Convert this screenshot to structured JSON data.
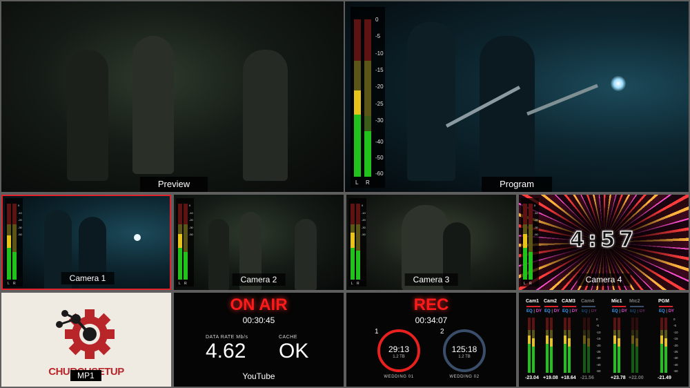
{
  "preview": {
    "label": "Preview"
  },
  "program": {
    "label": "Program",
    "meter_scale": [
      "0",
      "-5",
      "-10",
      "-15",
      "-20",
      "-25",
      "-30",
      "-40",
      "-50",
      "-60"
    ],
    "channels": [
      "L",
      "R"
    ]
  },
  "cameras": [
    {
      "label": "Camera 1",
      "meter_scale": [
        "0",
        "-5",
        "-10",
        "-15",
        "-20",
        "-25",
        "-30",
        "-40",
        "-50",
        "-60"
      ],
      "channels": [
        "L",
        "R"
      ]
    },
    {
      "label": "Camera 2",
      "meter_scale": [
        "0",
        "-5",
        "-10",
        "-15",
        "-20",
        "-25",
        "-30",
        "-40",
        "-50",
        "-60"
      ],
      "channels": [
        "L",
        "R"
      ]
    },
    {
      "label": "Camera 3",
      "meter_scale": [
        "0",
        "-5",
        "-10",
        "-15",
        "-20",
        "-25",
        "-30",
        "-40",
        "-50",
        "-60"
      ],
      "channels": [
        "L",
        "R"
      ]
    },
    {
      "label": "Camera 4",
      "meter_scale": [
        "0",
        "-5",
        "-10",
        "-15",
        "-20",
        "-25",
        "-30",
        "-40",
        "-50",
        "-60"
      ],
      "channels": [
        "L",
        "R"
      ],
      "countdown": "4:57"
    }
  ],
  "media_player": {
    "logo_text": "CHURCHSETUP",
    "label": "MP1"
  },
  "stream": {
    "title": "ON AIR",
    "timecode": "00:30:45",
    "data_rate_label": "DATA RATE Mb/s",
    "data_rate": "4.62",
    "cache_label": "CACHE",
    "cache": "OK",
    "platform": "YouTube"
  },
  "record": {
    "title": "REC",
    "timecode": "00:34:07",
    "disks": [
      {
        "index": "1",
        "time": "29:13",
        "size": "1.2 TB",
        "name": "WEDDING 01",
        "color": "#e8201e"
      },
      {
        "index": "2",
        "time": "125:18",
        "size": "1.2 TB",
        "name": "WEDDING 02",
        "color": "#3a4e6a"
      }
    ]
  },
  "audio_mixer": {
    "channels": [
      {
        "name": "Cam1",
        "eq": "EQ",
        "dy": "DY",
        "level": "-23.04",
        "active": true
      },
      {
        "name": "Cam2",
        "eq": "EQ",
        "dy": "DY",
        "level": "+19.08",
        "active": true
      },
      {
        "name": "CAM3",
        "eq": "EQ",
        "dy": "DY",
        "level": "+18.64",
        "active": true
      },
      {
        "name": "Cam4",
        "eq": "EQ",
        "dy": "DY",
        "level": "-21.56",
        "active": false
      },
      {
        "name": "Mic1",
        "eq": "EQ",
        "dy": "DY",
        "level": "+23.78",
        "active": true
      },
      {
        "name": "Mic2",
        "eq": "EQ",
        "dy": "DY",
        "level": "+22.00",
        "active": false
      },
      {
        "name": "PGM",
        "eq": "EQ",
        "dy": "DY",
        "level": "-21.49",
        "active": true
      }
    ],
    "meter_scale": [
      "0",
      "-5",
      "-10",
      "-15",
      "-20",
      "-25",
      "-30",
      "-40",
      "-50"
    ]
  },
  "colors": {
    "tally_red": "#e0202a",
    "meter_green": "#22c21c",
    "meter_yellow": "#e8c41a",
    "meter_red": "#7a1414",
    "brand_red": "#b8262a"
  }
}
